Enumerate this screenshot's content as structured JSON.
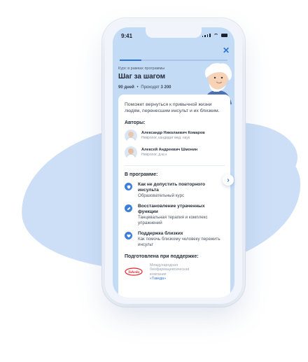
{
  "status": {
    "time": "9:41"
  },
  "course": {
    "subtitle": "Курс в рамках программы",
    "title": "Шаг за шагом",
    "duration": "90 дней",
    "bullet": "•",
    "passing_label": "Проходят",
    "passing_count": "3 200",
    "progress": 0.2
  },
  "description": "Поможет вернуться к привычной жизни людям, перенесшим инсульт и их близким.",
  "authors": {
    "heading": "Авторы:",
    "items": [
      {
        "name": "Александр Николаевич Комаров",
        "role": "Невролог, кандидат мед. наук"
      },
      {
        "name": "Алексей Андреевич Шмонин",
        "role": "Невролог, д.м.н"
      }
    ]
  },
  "program": {
    "heading": "В программе:",
    "items": [
      {
        "title": "Как не допустить повторного инсульта",
        "subtitle": "Образовательный курс",
        "icon": "shield-icon"
      },
      {
        "title": "Восстановление утраченных функции",
        "subtitle": "Танцевальная терапия и комплекс упражнений",
        "icon": "bandage-icon"
      },
      {
        "title": "Поддержка близких",
        "subtitle": "Как помочь близкому человеку пережить инсульт",
        "icon": "heart-icon"
      }
    ]
  },
  "support": {
    "heading": "Подготовлена при поддержке:",
    "text": "Международная биофармацевтическая компания",
    "link": "«Такеда»",
    "logo_text": "Takeda"
  },
  "colors": {
    "accent": "#2d74d8",
    "screen_bg": "#c4dbf5",
    "blob": "#cddff7"
  }
}
